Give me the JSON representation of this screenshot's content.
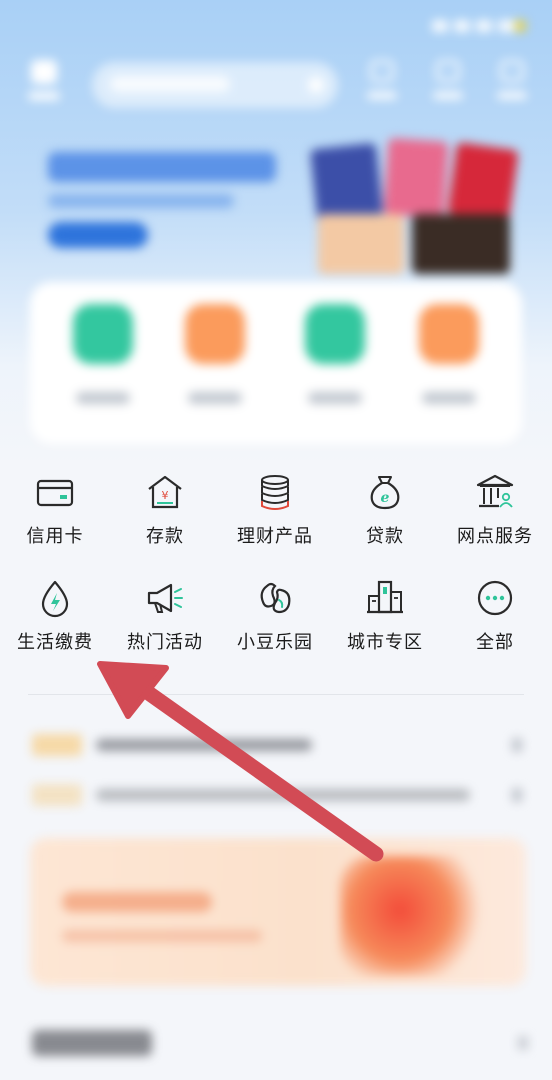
{
  "colors": {
    "header_gradient_top": "#a9d0f6",
    "page_background": "#f4f6fa",
    "icon_stroke": "#2b2b2b",
    "icon_accent_green": "#2fc49a",
    "icon_accent_red": "#e0493a",
    "annotation_arrow": "#d24b55"
  },
  "services": [
    {
      "label": "信用卡",
      "icon": "credit-card-icon"
    },
    {
      "label": "存款",
      "icon": "deposit-house-yen-icon"
    },
    {
      "label": "理财产品",
      "icon": "coin-stack-icon"
    },
    {
      "label": "贷款",
      "icon": "loan-money-bag-icon"
    },
    {
      "label": "网点服务",
      "icon": "bank-branch-icon"
    },
    {
      "label": "生活缴费",
      "icon": "water-drop-bolt-icon"
    },
    {
      "label": "热门活动",
      "icon": "megaphone-icon"
    },
    {
      "label": "小豆乐园",
      "icon": "beans-icon"
    },
    {
      "label": "城市专区",
      "icon": "city-buildings-icon"
    },
    {
      "label": "全部",
      "icon": "more-dots-icon"
    }
  ],
  "annotation": {
    "type": "arrow",
    "points_to": "生活缴费"
  }
}
